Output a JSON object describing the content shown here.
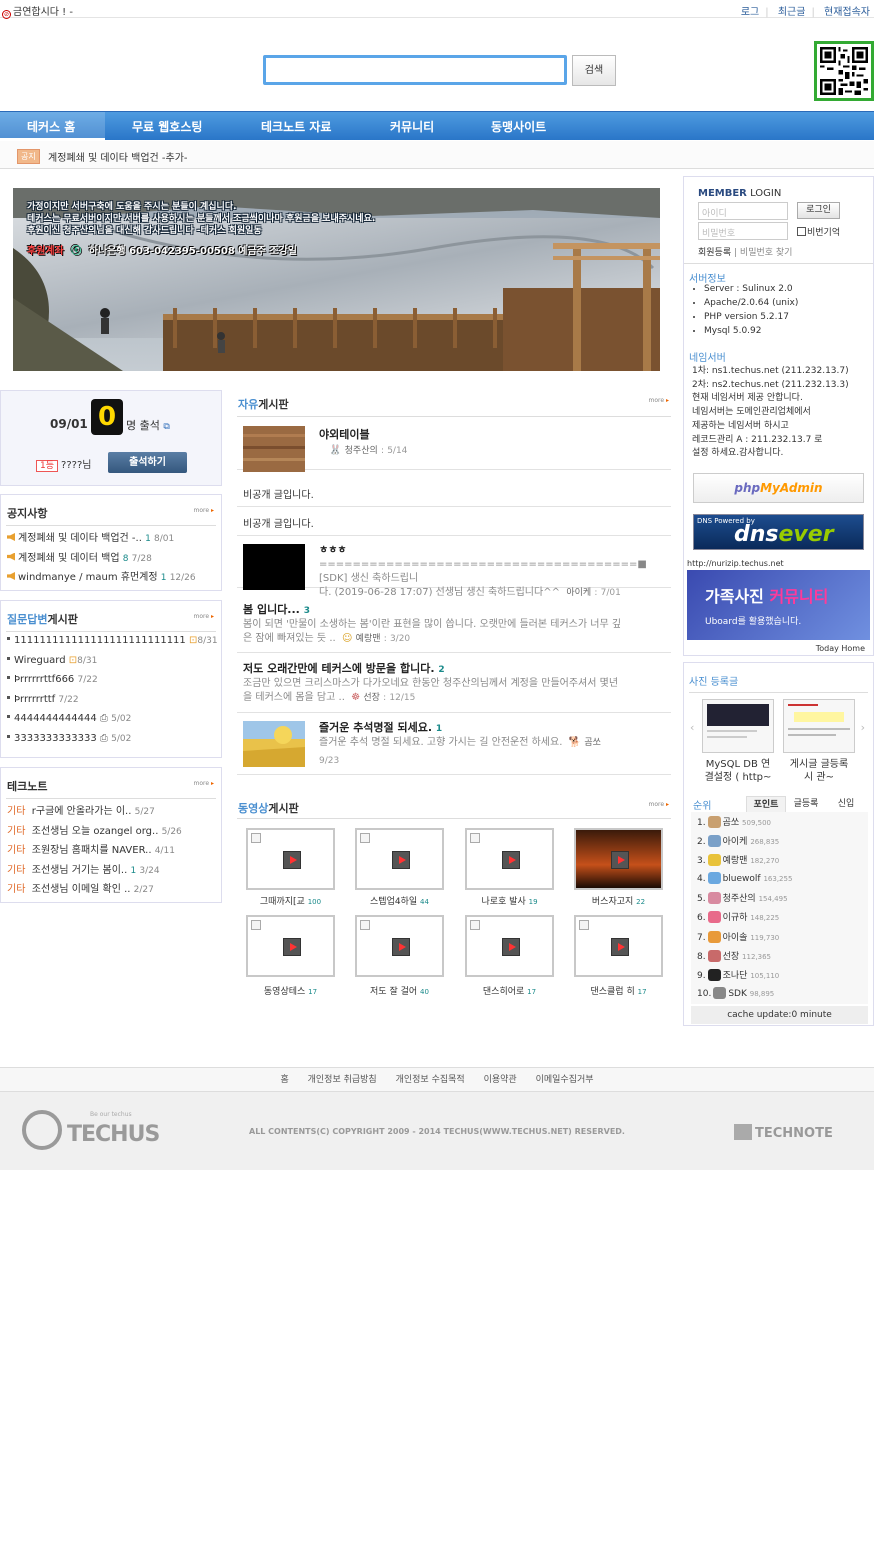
{
  "topbar": {
    "slogan": "금연합시다 ! -",
    "links": [
      "로그",
      "최근글",
      "현재접속자"
    ]
  },
  "search": {
    "placeholder": "",
    "button": "검색"
  },
  "nav": [
    "테커스 홈",
    "무료 웹호스팅",
    "테크노트 자료",
    "커뮤니티",
    "동맹사이트"
  ],
  "notice_bar": {
    "tag": "공지",
    "text": "계정폐쇄 및 데이타 백업건 -추가-"
  },
  "banner": {
    "lines": [
      "가정이지만 서버구축에 도움을 주시는 분들이 계십니다.",
      "테커스는 무료서버이지만 서버를 사용하시는 분들께서 조금씩이나마 후원금을 보내주시네요.",
      "후원이신 청주산의님을 대신해 감사드립니다          -테커스 회원일동"
    ],
    "bank_label": "후원계좌",
    "bank_name": "하나은행",
    "account": "603-042395-00508",
    "holder": "예금주 조강일"
  },
  "attendance": {
    "date": "09/01",
    "count": "0",
    "suffix": "명 출석",
    "rank_badge": "1등",
    "rank_name": "????님",
    "button": "출석하기"
  },
  "notices": {
    "title": "공지사항",
    "more": "more",
    "items": [
      {
        "text": "계정폐쇄 및 데이타 백업건 -..",
        "count": "1",
        "date": "8/01"
      },
      {
        "text": "계정폐쇄 및 데이터 백업",
        "count": "8",
        "date": "7/28"
      },
      {
        "text": "windmanye / maum 휴먼계정",
        "count": "1",
        "date": "12/26"
      }
    ]
  },
  "qna": {
    "title_hl": "질문답변",
    "title_rest": "게시판",
    "more": "more",
    "items": [
      {
        "text": "111111111111111111111111111",
        "date": "8/31"
      },
      {
        "text": "Wireguard",
        "date": "8/31"
      },
      {
        "text": "Þrrrrrrttf666",
        "date": "7/22"
      },
      {
        "text": "Þrrrrrrttf",
        "date": "7/22"
      },
      {
        "text": "4444444444444",
        "date": "5/02"
      },
      {
        "text": "3333333333333",
        "date": "5/02"
      }
    ]
  },
  "technote": {
    "title": "테크노트",
    "more": "more",
    "items": [
      {
        "cat": "기타",
        "text": "r구글에 안올라가는 이..",
        "date": "5/27"
      },
      {
        "cat": "기타",
        "text": "조선생님 오늘 ozangel org..",
        "date": "5/26"
      },
      {
        "cat": "기타",
        "text": "조원장님 홈패치를 NAVER..",
        "date": "4/11"
      },
      {
        "cat": "기타",
        "text": "조선생님 거기는 봄이..",
        "count": "1",
        "date": "3/24"
      },
      {
        "cat": "기타",
        "text": "조선생님 이메일 확인 ..",
        "date": "2/27"
      }
    ]
  },
  "freeboard": {
    "title_hl": "자유",
    "title_rest": "게시판",
    "more": "more",
    "posts": [
      {
        "title": "야외테이블",
        "author": "청주산의",
        "date": "5/14"
      },
      {
        "plain": "비공개 글입니다."
      },
      {
        "plain": "비공개 글입니다."
      },
      {
        "title": "ㅎㅎㅎ",
        "body1": "======================================■ [SDK] 생신 축하드립니",
        "body2": "다. (2019-06-28 17:07) 선생님 생신 축하드립니다^^",
        "author": "아이케",
        "date": "7/01"
      },
      {
        "title": "봄 입니다...",
        "count": "3",
        "body1": "봄이 되면 '만물이 소생하는 봄'이란 표현을 많이 씁니다. 오랫만에 들러본 테커스가 너무 깊",
        "body2": "은 잠에 빠져있는 듯 ..",
        "author": "예랑맨",
        "date": "3/20"
      },
      {
        "title": "저도 오래간만에 테커스에 방문을 합니다.",
        "count": "2",
        "body1": "조금만 있으면 크리스마스가 다가오네요 한동안 청주산의님께서 계정을 만들어주셔서 몇년",
        "body2": "을 테커스에 몸을 담고 ..",
        "author": "선장",
        "date": "12/15"
      },
      {
        "title": "즐거운 추석명절 되세요.",
        "count": "1",
        "body1": "즐거운 추석 명절 되세요. 고향 가시는 길 안전운전 하세요.",
        "author": "곰쏘",
        "date": "9/23"
      }
    ]
  },
  "videoboard": {
    "title_hl": "동영상",
    "title_rest": "게시판",
    "more": "more",
    "items": [
      {
        "label": "그때까지[교",
        "count": "100"
      },
      {
        "label": "스텝업4하일",
        "count": "44"
      },
      {
        "label": "나로호 발사",
        "count": "19"
      },
      {
        "label": "버스자고지",
        "count": "22"
      },
      {
        "label": "동영상테스",
        "count": "17"
      },
      {
        "label": "저도 잘 걸어",
        "count": "40"
      },
      {
        "label": "댄스히어로",
        "count": "17"
      },
      {
        "label": "댄스클럽 히",
        "count": "17"
      }
    ]
  },
  "member": {
    "title_strong": "MEMBER",
    "title_rest": " LOGIN",
    "id_placeholder": "아이디",
    "pw_placeholder": "비밀번호",
    "login": "로그인",
    "remember": "비번기억",
    "register": "회원등록",
    "find": "비밀번호 찾기"
  },
  "server": {
    "title": "서버정보",
    "items": [
      "Server : Sulinux 2.0",
      "Apache/2.0.64 (unix)",
      "PHP version 5.2.17",
      "Mysql 5.0.92"
    ]
  },
  "nameserver": {
    "title": "네임서버",
    "lines": [
      "1차: ns1.techus.net (211.232.13.7)",
      "2차: ns2.techus.net (211.232.13.3)",
      "현재 네임서버 제공 안합니다.",
      "네임서버는 도메인관리업체에서",
      "제공하는 네임서버 하시고",
      "레코드관리 A : 211.232.13.7 로",
      "설정 하세요.감사합니다."
    ]
  },
  "phpmyadmin": {
    "a": "php",
    "b": "MyAdmin"
  },
  "dnsever": {
    "small": "DNS Powered by",
    "a": "dns",
    "b": "ever"
  },
  "ad": {
    "url": "http://nurizip.techus.net",
    "title_a": "가족사진 ",
    "title_b": "커뮤니티",
    "sub": "Uboard를 활용했습니다.",
    "today": "Today Home"
  },
  "photos": {
    "title": "사진 등록글",
    "items": [
      {
        "caption1": "MySQL DB 연",
        "caption2": "결설정 ( http~"
      },
      {
        "caption1": "게시글 글등록",
        "caption2": "시 관~"
      }
    ]
  },
  "ranking": {
    "title": "순위",
    "tabs": [
      "포인트",
      "글등록",
      "신입"
    ],
    "items": [
      {
        "rank": "1.",
        "name": "곰쏘",
        "points": "509,500",
        "color": "#c9a070"
      },
      {
        "rank": "2.",
        "name": "아이케",
        "points": "268,835",
        "color": "#7aa0c8"
      },
      {
        "rank": "3.",
        "name": "예랑맨",
        "points": "182,270",
        "color": "#e8c23a"
      },
      {
        "rank": "4.",
        "name": "bluewolf",
        "points": "163,255",
        "color": "#6aa8e0"
      },
      {
        "rank": "5.",
        "name": "청주산의",
        "points": "154,495",
        "color": "#d88aa0"
      },
      {
        "rank": "6.",
        "name": "이규하",
        "points": "148,225",
        "color": "#e86a8a"
      },
      {
        "rank": "7.",
        "name": "아이솔",
        "points": "119,730",
        "color": "#e89a3a"
      },
      {
        "rank": "8.",
        "name": "선장",
        "points": "112,365",
        "color": "#c86a6a"
      },
      {
        "rank": "9.",
        "name": "조나단",
        "points": "105,110",
        "color": "#222222"
      },
      {
        "rank": "10.",
        "name": "SDK",
        "points": "98,895",
        "color": "#888888"
      }
    ],
    "cache": "cache update:0 minute"
  },
  "footer": {
    "links": [
      "홈",
      "개인정보 취급방침",
      "개인정보 수집목적",
      "이용약관",
      "이메일수집거부"
    ],
    "logo_small": "Be our techus",
    "logo": "TECHUS",
    "copyright": "ALL CONTENTS(C) COPYRIGHT 2009 - 2014 TECHUS(WWW.TECHUS.NET) RESERVED.",
    "technote": "TECHNOTE"
  },
  "colors": {
    "nav": "#2a76c8",
    "accent": "#4a8fd0",
    "search_border": "#5aa5e8"
  }
}
